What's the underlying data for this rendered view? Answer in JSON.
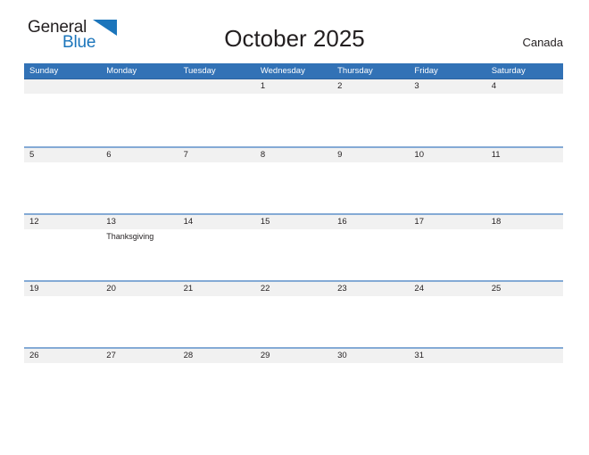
{
  "brand": {
    "name_part1": "General",
    "name_part2": "Blue",
    "accent_color": "#1b75bb",
    "triangle_icon": "triangle-icon"
  },
  "header": {
    "title": "October 2025",
    "country": "Canada"
  },
  "theme": {
    "header_blue": "#3272b6",
    "separator_blue": "#84aad5",
    "band_gray": "#f1f1f1",
    "text": "#231f20"
  },
  "calendar": {
    "weekdays": [
      "Sunday",
      "Monday",
      "Tuesday",
      "Wednesday",
      "Thursday",
      "Friday",
      "Saturday"
    ],
    "weeks": [
      {
        "days": [
          {
            "num": "",
            "event": ""
          },
          {
            "num": "",
            "event": ""
          },
          {
            "num": "",
            "event": ""
          },
          {
            "num": "1",
            "event": ""
          },
          {
            "num": "2",
            "event": ""
          },
          {
            "num": "3",
            "event": ""
          },
          {
            "num": "4",
            "event": ""
          }
        ]
      },
      {
        "days": [
          {
            "num": "5",
            "event": ""
          },
          {
            "num": "6",
            "event": ""
          },
          {
            "num": "7",
            "event": ""
          },
          {
            "num": "8",
            "event": ""
          },
          {
            "num": "9",
            "event": ""
          },
          {
            "num": "10",
            "event": ""
          },
          {
            "num": "11",
            "event": ""
          }
        ]
      },
      {
        "days": [
          {
            "num": "12",
            "event": ""
          },
          {
            "num": "13",
            "event": "Thanksgiving"
          },
          {
            "num": "14",
            "event": ""
          },
          {
            "num": "15",
            "event": ""
          },
          {
            "num": "16",
            "event": ""
          },
          {
            "num": "17",
            "event": ""
          },
          {
            "num": "18",
            "event": ""
          }
        ]
      },
      {
        "days": [
          {
            "num": "19",
            "event": ""
          },
          {
            "num": "20",
            "event": ""
          },
          {
            "num": "21",
            "event": ""
          },
          {
            "num": "22",
            "event": ""
          },
          {
            "num": "23",
            "event": ""
          },
          {
            "num": "24",
            "event": ""
          },
          {
            "num": "25",
            "event": ""
          }
        ]
      },
      {
        "days": [
          {
            "num": "26",
            "event": ""
          },
          {
            "num": "27",
            "event": ""
          },
          {
            "num": "28",
            "event": ""
          },
          {
            "num": "29",
            "event": ""
          },
          {
            "num": "30",
            "event": ""
          },
          {
            "num": "31",
            "event": ""
          },
          {
            "num": "",
            "event": ""
          }
        ]
      }
    ]
  }
}
